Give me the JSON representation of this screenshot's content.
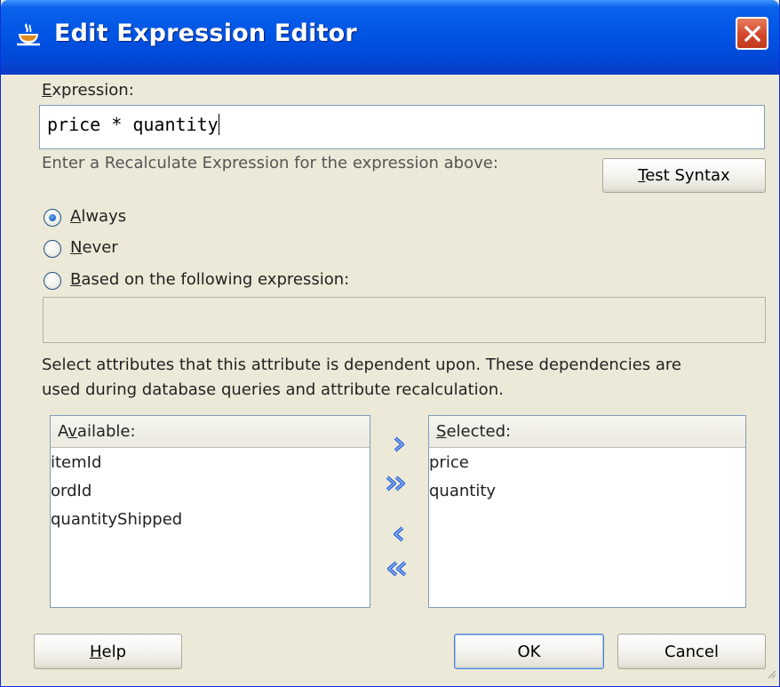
{
  "window": {
    "title": "Edit Expression Editor",
    "colors": {
      "titlebar": "#0055e5",
      "close": "#d2472a",
      "body": "#ece9d8"
    }
  },
  "expression": {
    "label_prefix": "",
    "label_mnemonic": "E",
    "label_rest": "xpression:",
    "value": "price * quantity"
  },
  "recalc_hint": "Enter a Recalculate Expression for the expression above:",
  "test_syntax": {
    "mnemonic": "T",
    "rest": "est Syntax"
  },
  "radios": {
    "always": {
      "mnemonic": "A",
      "rest": "lways",
      "checked": true
    },
    "never": {
      "mnemonic": "N",
      "rest": "ever",
      "checked": false
    },
    "based_on": {
      "mnemonic": "B",
      "rest": "ased on the following expression:",
      "checked": false
    }
  },
  "based_on_expression": "",
  "dependency_hint_line1": "Select attributes that this attribute is dependent upon. These dependencies are",
  "dependency_hint_line2": "used during database queries and attribute recalculation.",
  "available": {
    "header_pre": "A",
    "header_mnemonic": "v",
    "header_rest": "ailable:",
    "items": [
      "itemId",
      "ordId",
      "quantityShipped"
    ]
  },
  "selected": {
    "header_mnemonic": "S",
    "header_rest": "elected:",
    "items": [
      "price",
      "quantity"
    ]
  },
  "shuttle_icons": [
    "move-right-icon",
    "move-all-right-icon",
    "move-left-icon",
    "move-all-left-icon"
  ],
  "footer": {
    "help": {
      "mnemonic": "H",
      "rest": "elp"
    },
    "ok": "OK",
    "cancel": "Cancel"
  }
}
